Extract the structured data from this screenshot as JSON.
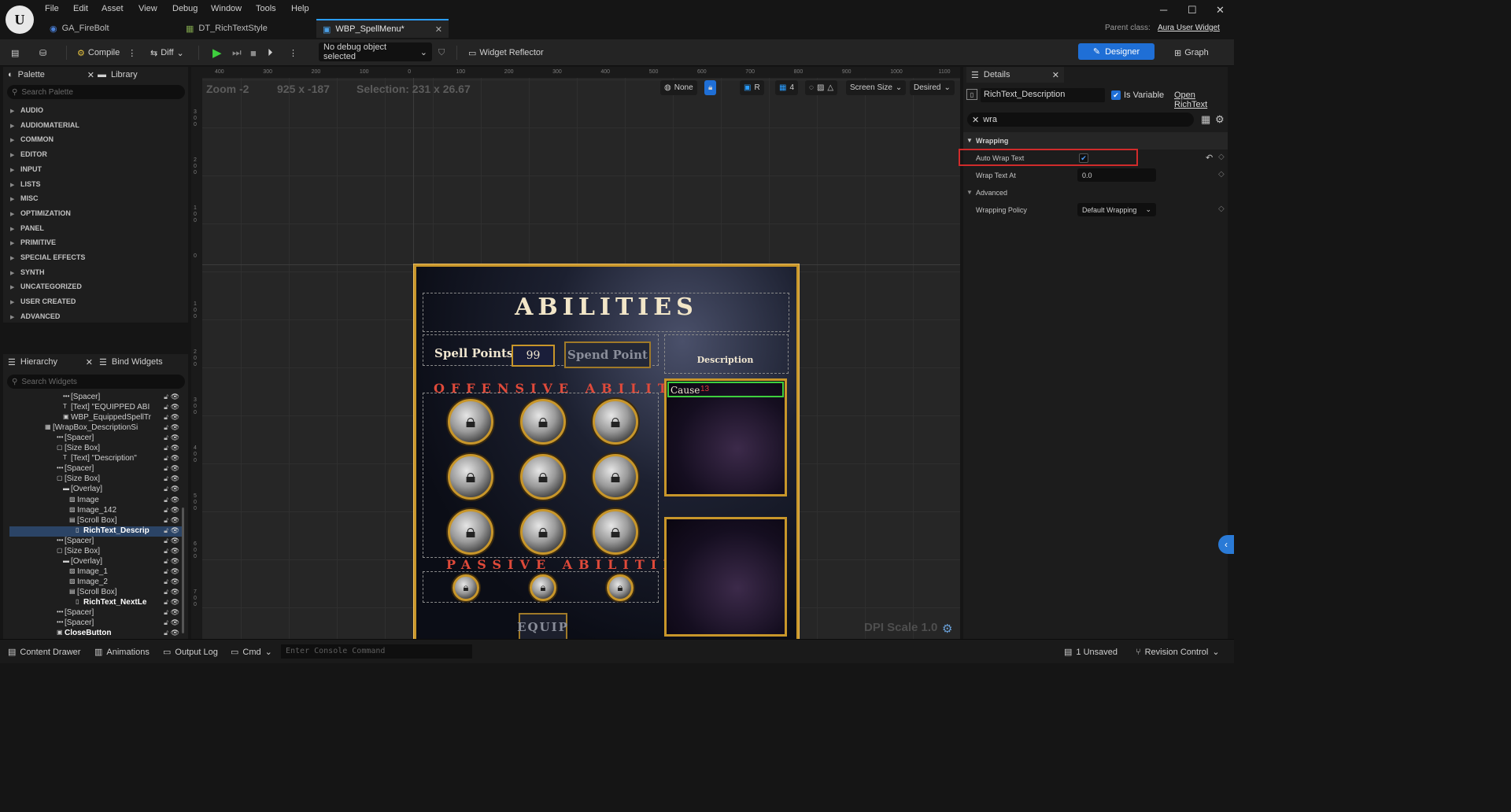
{
  "menu": {
    "file": "File",
    "edit": "Edit",
    "asset": "Asset",
    "view": "View",
    "debug": "Debug",
    "window": "Window",
    "tools": "Tools",
    "help": "Help"
  },
  "tabs": [
    {
      "label": "GA_FireBolt"
    },
    {
      "label": "DT_RichTextStyle"
    },
    {
      "label": "WBP_SpellMenu*"
    }
  ],
  "parent": {
    "label": "Parent class:",
    "value": "Aura User Widget"
  },
  "toolbar": {
    "compile": "Compile",
    "diff": "Diff",
    "debug_object": "No debug object selected",
    "reflector": "Widget Reflector",
    "designer": "Designer",
    "graph": "Graph"
  },
  "palette": {
    "tab": "Palette",
    "library": "Library",
    "search_placeholder": "Search Palette",
    "categories": [
      "AUDIO",
      "AUDIOMATERIAL",
      "COMMON",
      "EDITOR",
      "INPUT",
      "LISTS",
      "MISC",
      "OPTIMIZATION",
      "PANEL",
      "PRIMITIVE",
      "SPECIAL EFFECTS",
      "SYNTH",
      "UNCATEGORIZED",
      "USER CREATED",
      "ADVANCED"
    ]
  },
  "hierarchy": {
    "tab": "Hierarchy",
    "bind": "Bind Widgets",
    "search_placeholder": "Search Widgets",
    "rows": [
      {
        "label": "[Spacer]"
      },
      {
        "label": "[Text] \"EQUIPPED ABI"
      },
      {
        "label": "WBP_EquippedSpellTr"
      },
      {
        "label": "[WrapBox_DescriptionSi"
      },
      {
        "label": "[Spacer]"
      },
      {
        "label": "[Size Box]"
      },
      {
        "label": "[Text] \"Description\""
      },
      {
        "label": "[Spacer]"
      },
      {
        "label": "[Size Box]"
      },
      {
        "label": "[Overlay]"
      },
      {
        "label": "Image"
      },
      {
        "label": "Image_142"
      },
      {
        "label": "[Scroll Box]"
      },
      {
        "label": "RichText_Descrip"
      },
      {
        "label": "[Spacer]"
      },
      {
        "label": "[Size Box]"
      },
      {
        "label": "[Overlay]"
      },
      {
        "label": "Image_1"
      },
      {
        "label": "Image_2"
      },
      {
        "label": "[Scroll Box]"
      },
      {
        "label": "RichText_NextLe"
      },
      {
        "label": "[Spacer]"
      },
      {
        "label": "[Spacer]"
      },
      {
        "label": "CloseButton"
      }
    ]
  },
  "viewport": {
    "zoom": "Zoom -2",
    "coords": "925 x -187",
    "selection": "Selection: 231 x 26.67",
    "none": "None",
    "grid_size": "4",
    "screen_size": "Screen Size",
    "desired": "Desired",
    "dpi": "DPI Scale 1.0",
    "ruler_top": [
      "400",
      "300",
      "200",
      "100",
      "0",
      "100",
      "200",
      "300",
      "400",
      "500",
      "600",
      "700",
      "800",
      "900",
      "1000",
      "1100"
    ],
    "ruler_left": [
      "3 0 0",
      "2 0 0",
      "1 0 0",
      "0",
      "1 0 0",
      "2 0 0",
      "3 0 0",
      "4 0 0",
      "5 0 0",
      "6 0 0",
      "7 0 0"
    ]
  },
  "widget": {
    "title": "ABILITIES",
    "spell_points": "Spell Points",
    "points_value": "99",
    "spend": "Spend Point",
    "description_header": "Description",
    "offensive": "OFFENSIVE ABILITIES",
    "passive": "PASSIVE ABILITIES",
    "rich_text": "Cause",
    "rich_num": "13",
    "equip": "EQUIP"
  },
  "details": {
    "tab": "Details",
    "name": "RichText_Description",
    "is_variable": "Is Variable",
    "open": "Open RichText",
    "filter": "wra",
    "section": "Wrapping",
    "auto_wrap": "Auto Wrap Text",
    "wrap_at": "Wrap Text At",
    "wrap_at_value": "0.0",
    "advanced": "Advanced",
    "policy": "Wrapping Policy",
    "policy_value": "Default Wrapping",
    "auto_wrap_checked": true
  },
  "status": {
    "drawer": "Content Drawer",
    "anim": "Animations",
    "log": "Output Log",
    "cmd": "Cmd",
    "console_placeholder": "Enter Console Command",
    "unsaved": "1 Unsaved",
    "revision": "Revision Control"
  },
  "colors": {
    "accent": "#1f6fd6",
    "gold": "#c8962a",
    "red_title": "#e04a3a",
    "highlight": "#d02b2b",
    "select_green": "#3ecf3e"
  }
}
